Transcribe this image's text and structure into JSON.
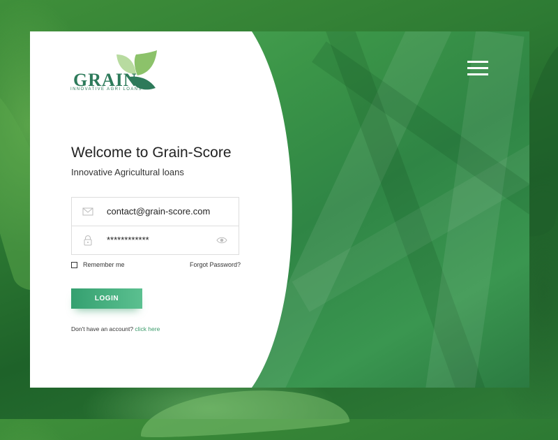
{
  "brand": {
    "name": "GRAIN",
    "tagline": "INNOVATIVE AGRI LOANS",
    "colors": {
      "primary": "#2d7a5a",
      "accent": "#3a9a6a",
      "leaf_light": "#a8d08a"
    }
  },
  "menu": {
    "icon": "hamburger-menu-icon"
  },
  "login": {
    "title": "Welcome to Grain-Score",
    "subtitle": "Innovative Agricultural loans",
    "email": {
      "icon": "envelope-icon",
      "value": "contact@grain-score.com"
    },
    "password": {
      "icon": "lock-icon",
      "value": "************",
      "toggle_icon": "eye-icon"
    },
    "remember_label": "Remember me",
    "remember_checked": false,
    "forgot_label": "Forgot Password?",
    "button_label": "LOGIN",
    "signup_prompt": "Don't have an account?",
    "signup_link": "click here"
  }
}
